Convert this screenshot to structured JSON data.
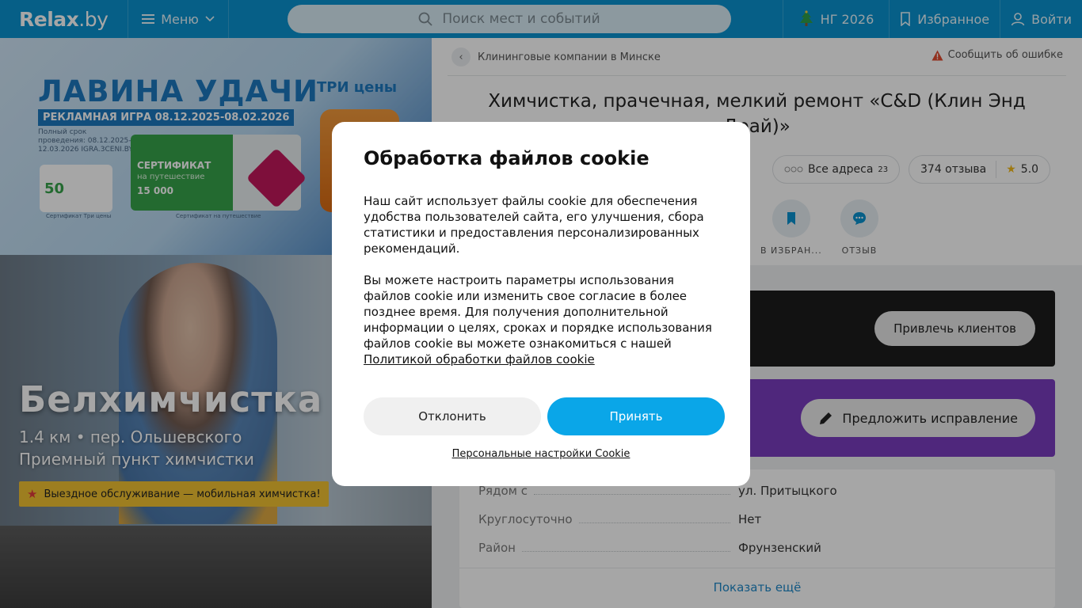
{
  "header": {
    "logo_main": "Relax",
    "logo_tld": ".by",
    "menu_label": "Меню",
    "search_placeholder": "Поиск мест и событий",
    "ng_label": "НГ 2026",
    "favorites_label": "Избранное",
    "login_label": "Войти"
  },
  "promo": {
    "title": "ЛАВИНА УДАЧИ",
    "subtitle": "РЕКЛАМНАЯ ИГРА 08.12.2025-08.02.2026",
    "small_text": "Полный срок проведения: 08.12.2025-12.03.2026 IGRA.3CENI.BY",
    "brand": "ТРИ цены",
    "card_value": "50",
    "cert_title": "СЕРТИФИКАТ",
    "cert_sub": "на путешествие",
    "cert_value": "15 000",
    "caption_left": "Сертификат Три цены",
    "caption_right": "Сертификат на путешествие"
  },
  "hero": {
    "title": "Белхимчистка",
    "line1": "1.4 км • пер. Ольшевского",
    "line2": "Приемный пункт химчистки",
    "tag": "Выездное обслуживание — мобильная химчистка!"
  },
  "page": {
    "breadcrumb": "Клининговые компании в Минске",
    "report": "Сообщить об ошибке",
    "title": "Химчистка, прачечная, мелкий ремонт «C&D (Клин Энд Драй)»",
    "addresses_label": "Все адреса",
    "addresses_count": "23",
    "reviews_label": "374 отзыва",
    "rating": "5.0",
    "action_favorite": "В ИЗБРАН...",
    "action_review": "ОТЗЫВ",
    "attract_button": "Привлечь клиентов",
    "suggest_button": "Предложить исправление",
    "info_rows": [
      {
        "key": "Рядом с",
        "value": "ул. Притыцкого"
      },
      {
        "key": "Круглосуточно",
        "value": "Нет"
      },
      {
        "key": "Район",
        "value": "Фрунзенский"
      }
    ],
    "show_more": "Показать ещё"
  },
  "cookie_modal": {
    "title": "Обработка файлов cookie",
    "text1": "Наш сайт использует файлы cookie для обеспечения удобства пользователей сайта, его улучшения, сбора статистики и предоставления персонализированных рекомендаций.",
    "text2": "Вы можете настроить параметры использования файлов cookie или изменить свое согласие в более позднее время. Для получения дополнительной информации о целях, сроках и порядке использования файлов cookie вы можете ознакомиться с нашей",
    "policy_link": "Политикой обработки файлов cookie",
    "decline": "Отклонить",
    "accept": "Принять",
    "settings_link": "Персональные настройки Cookie"
  },
  "colors": {
    "brand_blue": "#0a93cf",
    "accept_blue": "#0aa6e8",
    "purple_card": "#7a3dbf",
    "dark_card": "#1c1c1c",
    "tag_yellow": "#f1c232"
  },
  "icons": [
    "menu-icon",
    "chevron-down-icon",
    "search-icon",
    "tree-icon",
    "bookmark-icon",
    "user-icon",
    "chevron-left-icon",
    "warning-icon",
    "dots-icon",
    "star-icon",
    "chat-icon",
    "pencil-icon"
  ]
}
